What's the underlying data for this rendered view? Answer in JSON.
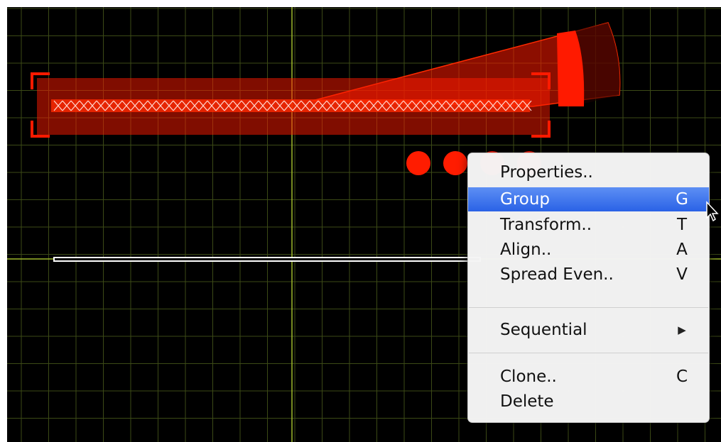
{
  "canvas": {
    "background": "#000000",
    "grid_color": "#3c4a16",
    "axis_color": "#9db82a",
    "selection_color": "#ff1a00"
  },
  "object_toolbar": [
    {
      "icon": "move-icon"
    },
    {
      "icon": "wrench-icon"
    },
    {
      "icon": "box-icon"
    },
    {
      "icon": "help-icon"
    }
  ],
  "context_menu": {
    "items": [
      {
        "label": "Properties..",
        "shortcut": ""
      },
      {
        "label": "Group",
        "shortcut": "G",
        "highlighted": true
      },
      {
        "label": "Transform..",
        "shortcut": "T"
      },
      {
        "label": "Align..",
        "shortcut": "A"
      },
      {
        "label": "Spread Even..",
        "shortcut": "V"
      },
      {
        "label": "Sequential",
        "submenu_icon": "triangle-right-icon"
      },
      {
        "label": "Clone..",
        "shortcut": "C"
      },
      {
        "label": "Delete",
        "shortcut": ""
      }
    ],
    "highlight_color": "#3f78ee"
  },
  "cursor": {
    "icon": "arrow-cursor-icon"
  }
}
